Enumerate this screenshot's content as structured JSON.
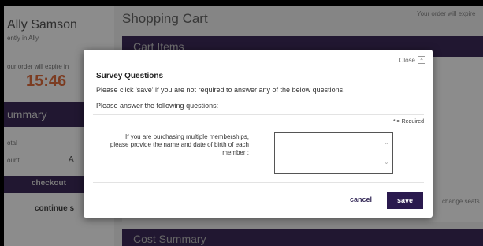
{
  "background": {
    "user_name": "Ally Samson",
    "user_sub": "ently in Ally",
    "expire_label": "our order will expire in",
    "timer": "15:46",
    "summary_title": "ummary",
    "total_label": "otal",
    "discount_label": "ount",
    "discount_apply": "A",
    "checkout_label": "checkout",
    "continue_label": "continue s",
    "page_title": "Shopping Cart",
    "expire_top": "Your order will expire",
    "cart_header": "Cart Items",
    "change_seats": "change seats",
    "cost_header": "Cost Summary"
  },
  "modal": {
    "close_label": "Close",
    "close_glyph": "×",
    "title": "Survey Questions",
    "line1": "Please click 'save' if you are not required to answer any of the below questions.",
    "line2": "Please answer the following questions:",
    "required_note": "* = Required",
    "question": "If you are purchasing multiple memberships, please provide the name and date of birth of each member :",
    "answer_value": "",
    "cancel_label": "cancel",
    "save_label": "save"
  }
}
